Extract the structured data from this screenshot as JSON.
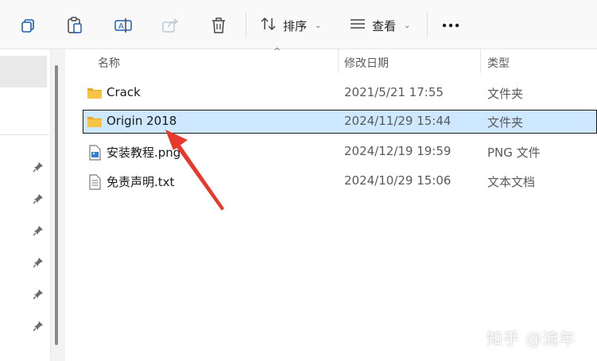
{
  "toolbar": {
    "sort_label": "排序",
    "view_label": "查看",
    "icons": [
      "copy-icon",
      "paste-icon",
      "rename-icon",
      "share-icon",
      "delete-icon",
      "sort-icon",
      "view-icon",
      "more-icon",
      "chevron-down-icon"
    ]
  },
  "columns": {
    "name": "名称",
    "date": "修改日期",
    "type": "类型"
  },
  "files": [
    {
      "name": "Crack",
      "date": "2021/5/21 17:55",
      "type": "文件夹",
      "icon": "folder-icon",
      "selected": false
    },
    {
      "name": "Origin 2018",
      "date": "2024/11/29 15:44",
      "type": "文件夹",
      "icon": "folder-icon",
      "selected": true
    },
    {
      "name": "安装教程.png",
      "date": "2024/12/19 19:59",
      "type": "PNG 文件",
      "icon": "image-file-icon",
      "selected": false
    },
    {
      "name": "免责声明.txt",
      "date": "2024/10/29 15:06",
      "type": "文本文档",
      "icon": "text-file-icon",
      "selected": false
    }
  ],
  "watermark": "知乎 @流年",
  "colors": {
    "selection": "#cde8ff",
    "folder": "#f6c445",
    "arrow": "#e8382d"
  }
}
